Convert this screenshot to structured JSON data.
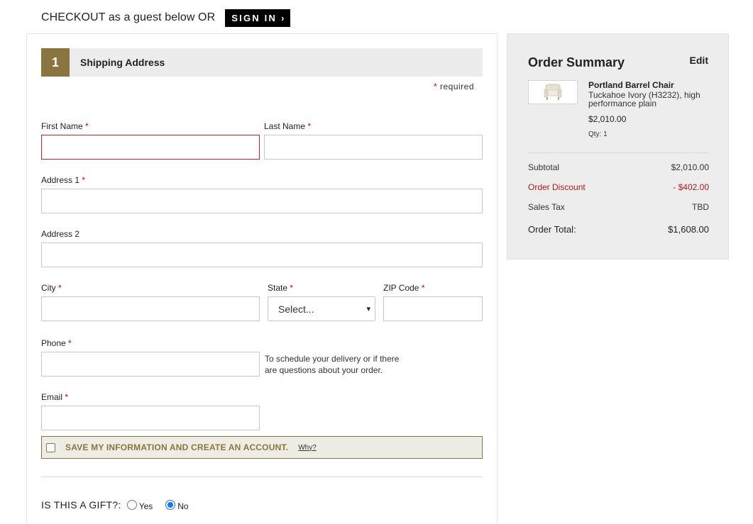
{
  "header": {
    "title": "CHECKOUT as a guest below OR",
    "signin_label": "SIGN IN"
  },
  "shipping": {
    "step_number": "1",
    "section_title": "Shipping Address",
    "required_note": "required",
    "fields": {
      "first_name": {
        "label": "First Name",
        "value": ""
      },
      "last_name": {
        "label": "Last Name",
        "value": ""
      },
      "address1": {
        "label": "Address 1",
        "value": ""
      },
      "address2": {
        "label": "Address 2",
        "value": ""
      },
      "city": {
        "label": "City",
        "value": ""
      },
      "state": {
        "label": "State",
        "selected": "Select..."
      },
      "zip": {
        "label": "ZIP Code",
        "value": ""
      },
      "phone": {
        "label": "Phone",
        "value": "",
        "helper": "To schedule your delivery or if there are questions about your order."
      },
      "email": {
        "label": "Email",
        "value": ""
      }
    },
    "save_account": {
      "label": "SAVE MY INFORMATION AND CREATE AN ACCOUNT.",
      "why_link": "Why?",
      "checked": false
    },
    "gift": {
      "question": "IS THIS A GIFT?:",
      "yes_label": "Yes",
      "no_label": "No",
      "selected": "No"
    }
  },
  "order_summary": {
    "title": "Order Summary",
    "edit_label": "Edit",
    "item": {
      "name": "Portland Barrel Chair",
      "description": "Tuckahoe Ivory (H3232), high performance plain",
      "price": "$2,010.00",
      "qty": "Qty: 1"
    },
    "subtotal": {
      "label": "Subtotal",
      "value": "$2,010.00"
    },
    "discount": {
      "label": "Order Discount",
      "value": "- $402.00"
    },
    "tax": {
      "label": "Sales Tax",
      "value": "TBD"
    },
    "total": {
      "label": "Order Total:",
      "value": "$1,608.00"
    }
  },
  "colors": {
    "accent_gold": "#8a7540",
    "error_red": "#cc1f1f",
    "discount_red": "#b21a1a"
  }
}
